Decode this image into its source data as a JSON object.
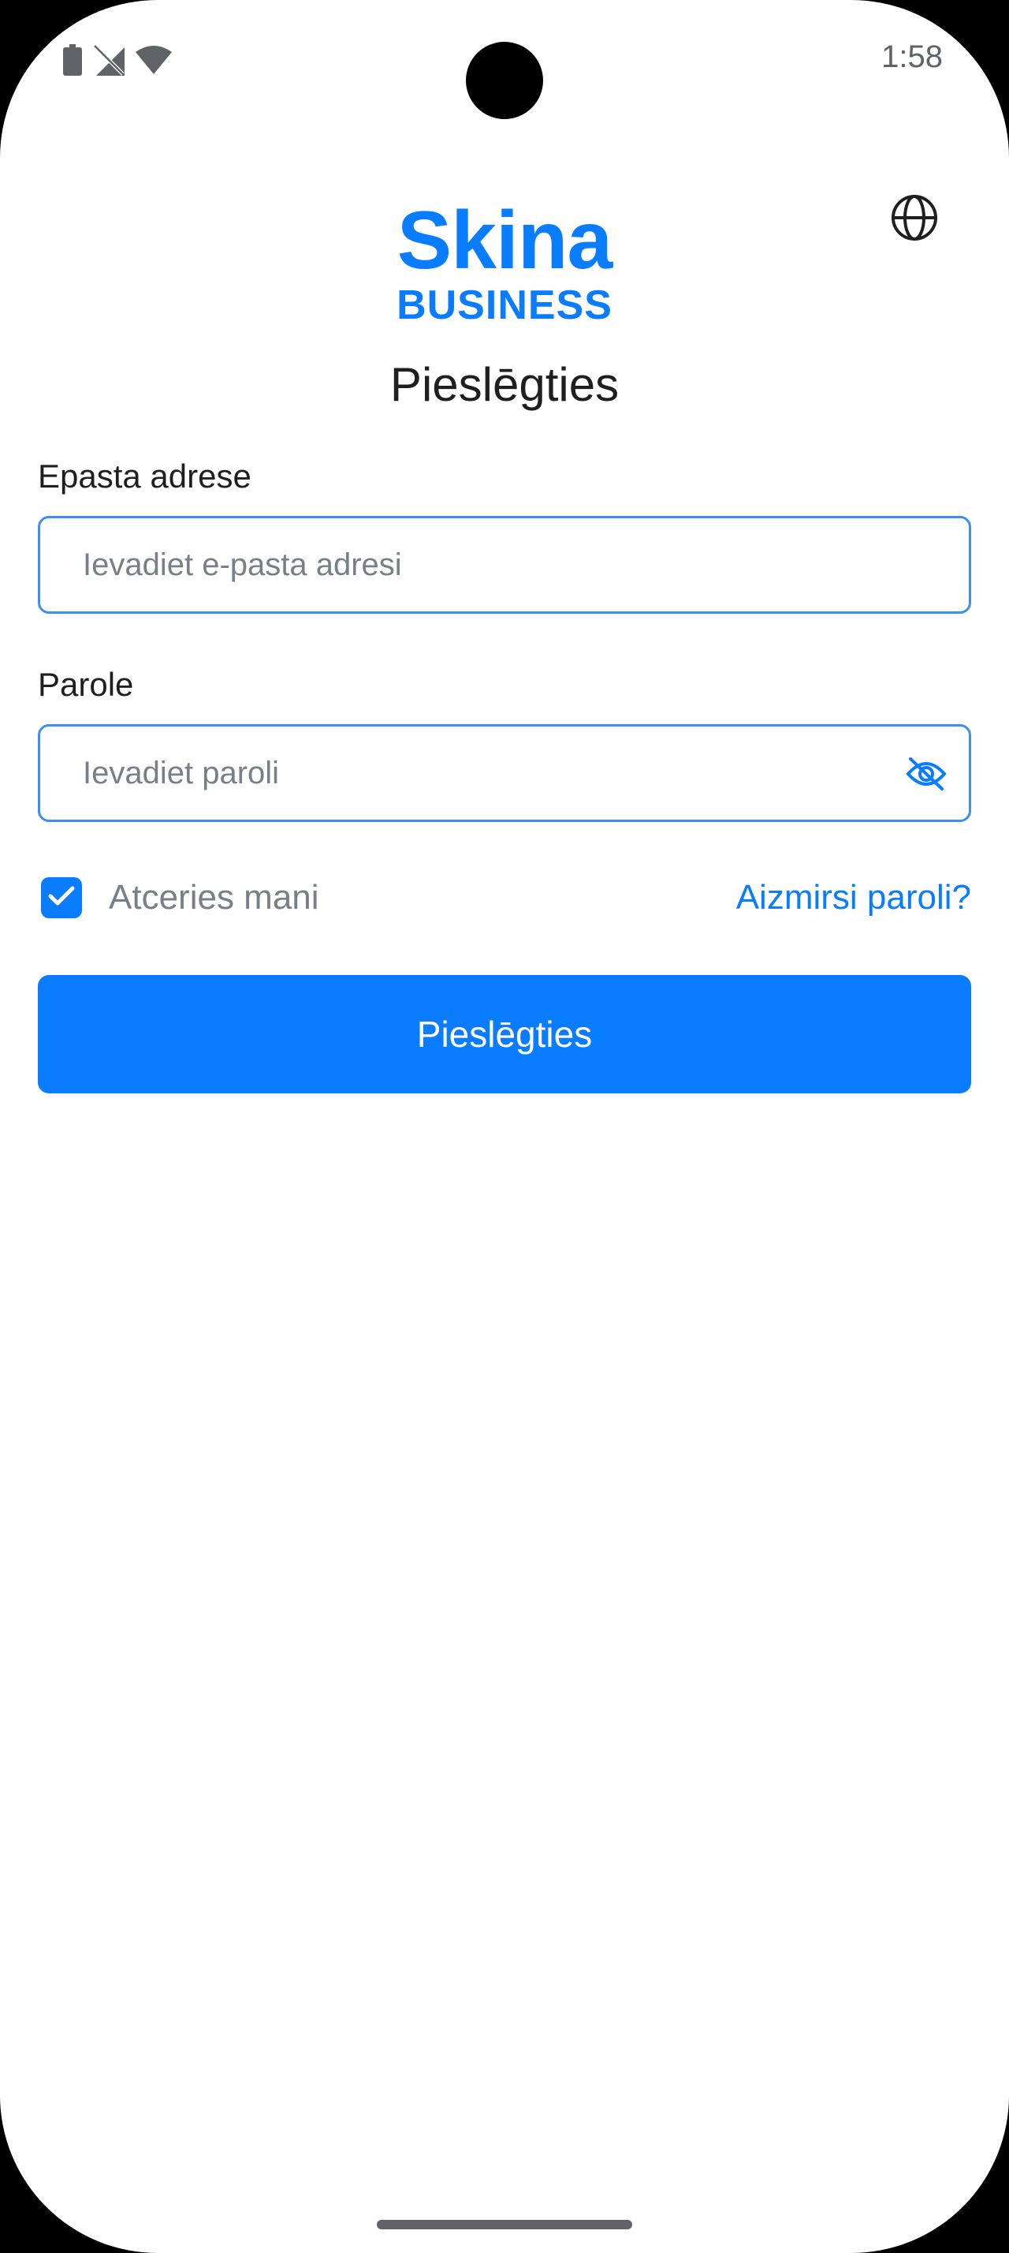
{
  "status_bar": {
    "time": "1:58",
    "icons": [
      "battery-icon",
      "no-signal-icon",
      "wifi-icon"
    ]
  },
  "header": {
    "language_icon": "globe-icon"
  },
  "logo": {
    "top_text": "Skina",
    "bottom_text": "BUSINESS",
    "color": "#0a7cff"
  },
  "page_title": "Pieslēgties",
  "form": {
    "email": {
      "label": "Epasta adrese",
      "placeholder": "Ievadiet e-pasta adresi",
      "value": ""
    },
    "password": {
      "label": "Parole",
      "placeholder": "Ievadiet paroli",
      "value": "",
      "toggle_icon": "eye-off-icon"
    },
    "remember_me": {
      "label": "Atceries mani",
      "checked": true
    },
    "forgot_password_label": "Aizmirsi paroli?",
    "submit_label": "Pieslēgties"
  },
  "colors": {
    "accent": "#0a7cff",
    "input_border": "#3d8ff2",
    "muted_text": "#7a7f87",
    "text": "#1f1f1f"
  }
}
